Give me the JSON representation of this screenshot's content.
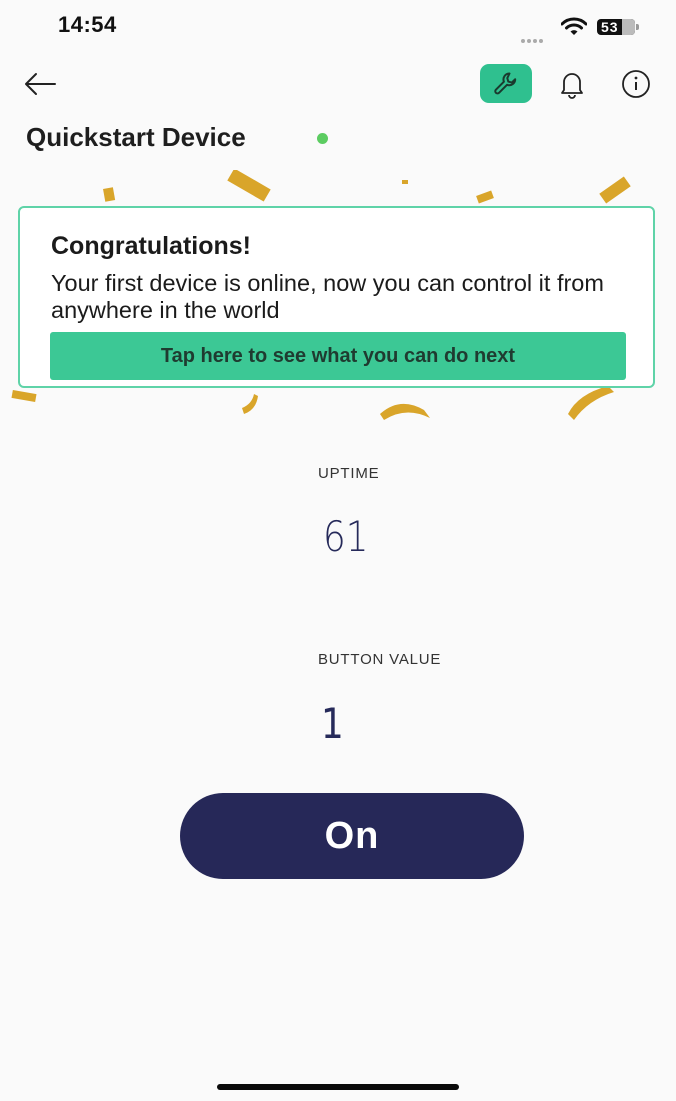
{
  "status_bar": {
    "time": "14:54",
    "battery": "53"
  },
  "header": {
    "back_icon": "arrow-left-icon",
    "actions": [
      "wrench-icon",
      "bell-icon",
      "info-icon"
    ],
    "accent_color": "#2fc08f"
  },
  "device": {
    "title": "Quickstart Device",
    "online_color": "#5ccc61"
  },
  "banner": {
    "title": "Congratulations!",
    "text": "Your first device is online, now you can control it from anywhere in the world",
    "button_label": "Tap here to see what you can do next",
    "border_color": "#5fd3a8",
    "button_color": "#3cc895"
  },
  "widgets": {
    "uptime": {
      "label": "UPTIME",
      "value": "61"
    },
    "button_value": {
      "label": "BUTTON VALUE",
      "value": "1"
    }
  },
  "switch": {
    "label": "On",
    "color": "#262858"
  }
}
